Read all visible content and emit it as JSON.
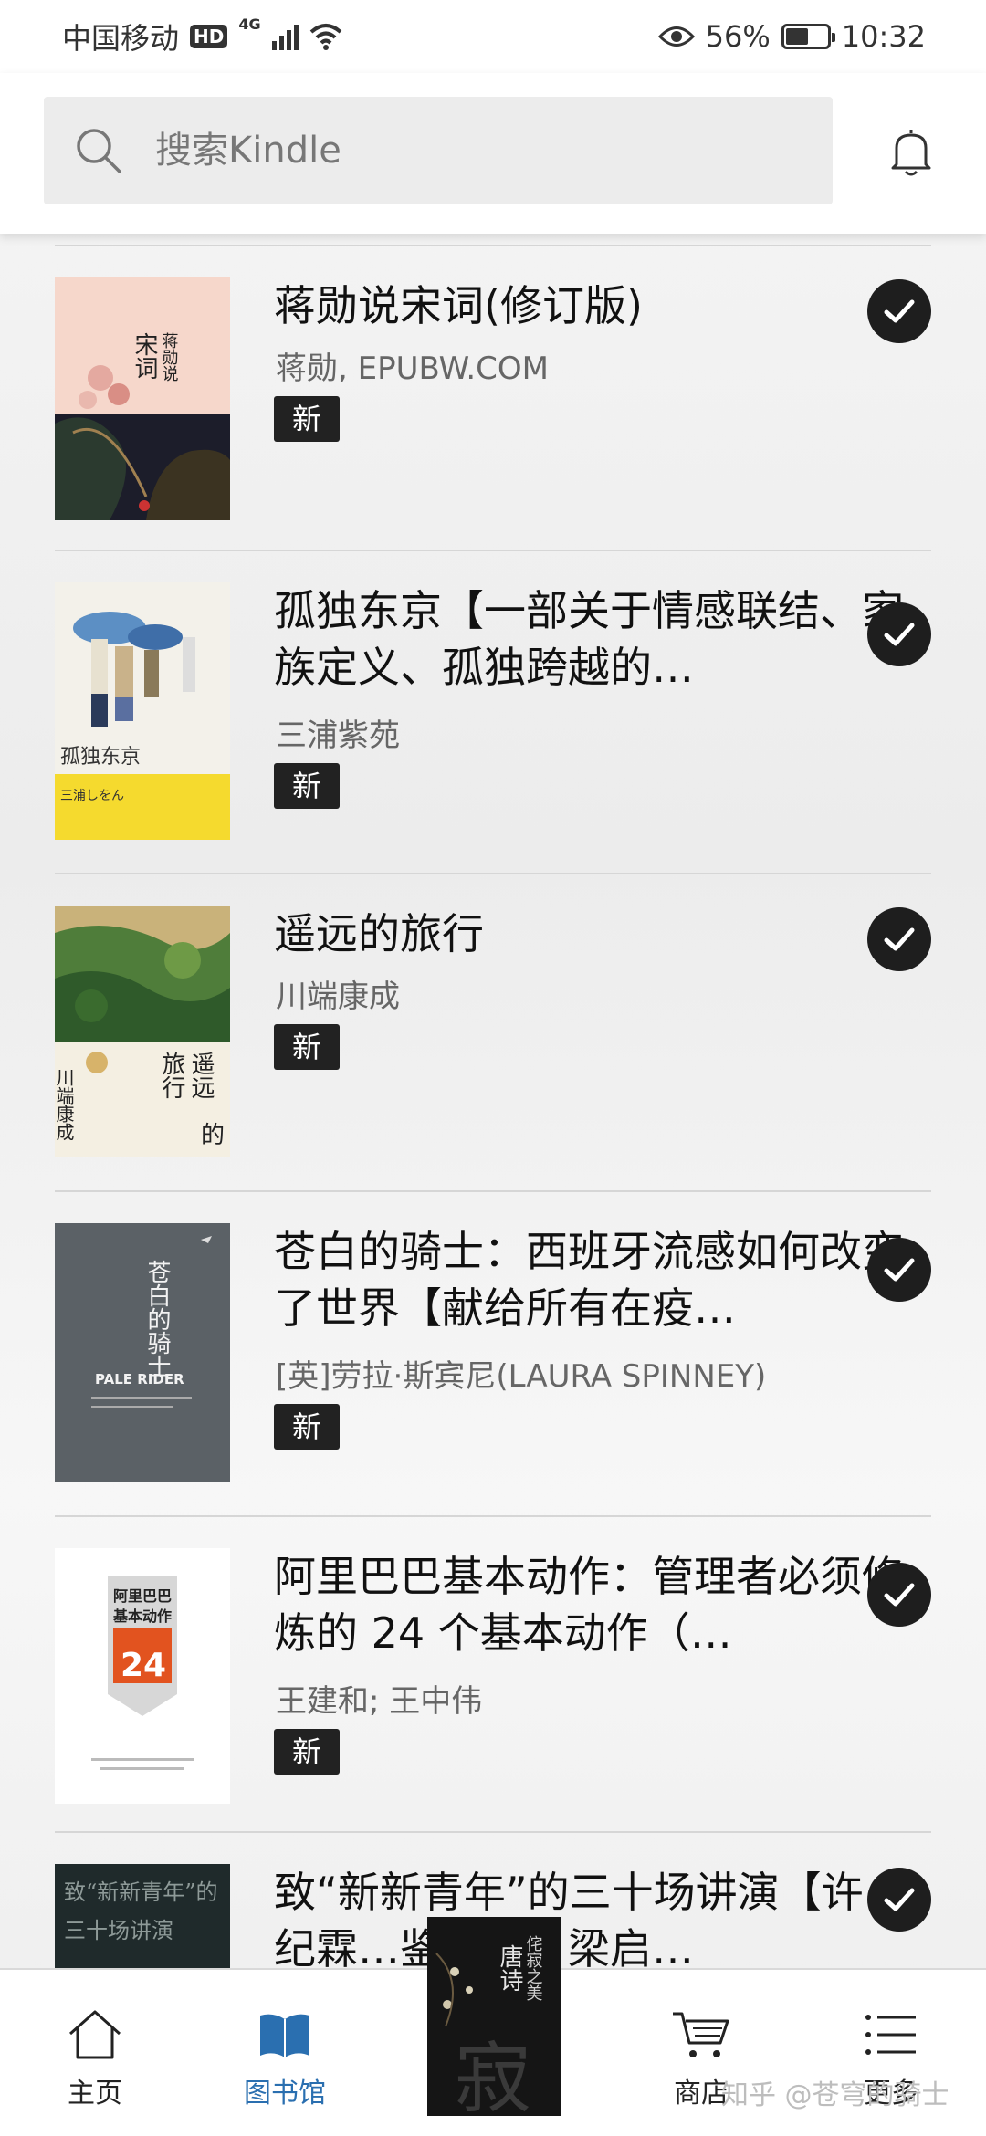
{
  "status_bar": {
    "carrier": "中国移动",
    "hd": "HD",
    "network": "4G",
    "battery": "56%",
    "time": "10:32"
  },
  "search": {
    "placeholder": "搜索Kindle"
  },
  "books": [
    {
      "title": "蒋勋说宋词(修订版)",
      "author": "蒋勋, EPUBW.COM",
      "badge": "新"
    },
    {
      "title": "孤独东京【一部关于情感联结、家族定义、孤独跨越的…",
      "author": "三浦紫苑",
      "badge": "新"
    },
    {
      "title": "遥远的旅行",
      "author": "川端康成",
      "badge": "新"
    },
    {
      "title": "苍白的骑士：西班牙流感如何改变了世界【献给所有在疫…",
      "author": "[英]劳拉·斯宾尼(LAURA SPINNEY)",
      "badge": "新"
    },
    {
      "title": "阿里巴巴基本动作：管理者必须修炼的 24 个基本动作（…",
      "author": "王建和; 王中伟",
      "badge": "新"
    },
    {
      "title": "致“新新青年”的三十场讲演【许纪霖…鉴推荐！梁启…",
      "author": "",
      "badge": ""
    }
  ],
  "covers": {
    "book1": {
      "text_a": "蒋勋说",
      "text_b": "宋词"
    },
    "book2": {
      "text": "孤独东京",
      "subtext": "三浦しをん"
    },
    "book3": {
      "text_a": "遥远",
      "text_b": "旅行",
      "text_c": "的",
      "author": "川端康成"
    },
    "book4": {
      "text": "苍白的骑士",
      "subtext": "PALE RIDER"
    },
    "book5": {
      "text_a": "阿里巴巴",
      "text_b": "基本动作",
      "number": "24"
    },
    "book6": {
      "text": "致“新新青年”的三十场讲演"
    }
  },
  "now_reading": {
    "title": "唐诗",
    "subtitle": "侘寂之美",
    "glyph": "寂"
  },
  "nav": {
    "home": "主页",
    "library": "图书馆",
    "store": "商店",
    "more": "更多"
  },
  "watermark": "知乎 @苍穹的骑士",
  "colors": {
    "accent": "#2a6fb0",
    "badge": "#222222",
    "check": "#1e1e1e"
  }
}
